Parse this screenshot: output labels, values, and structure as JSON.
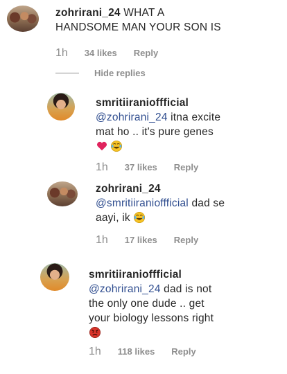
{
  "comments": [
    {
      "username": "zohrirani_24",
      "line1": "WHAT A",
      "line2": "HANDSOME MAN YOUR SON IS",
      "time": "1h",
      "likes": "34 likes",
      "reply": "Reply"
    },
    {
      "username": "smritiiranioffficial",
      "mention": "@zohrirani_24",
      "line1": "itna excite",
      "line2": "mat ho .. it's pure genes",
      "emojis": [
        "heart-emoji",
        "tears-of-joy-emoji"
      ],
      "time": "1h",
      "likes": "37 likes",
      "reply": "Reply"
    },
    {
      "username": "zohrirani_24",
      "mention": "@smritiiranioffficial",
      "line1": "dad se",
      "line2": "aayi, ik",
      "emojis": [
        "tears-of-joy-emoji"
      ],
      "time": "1h",
      "likes": "17 likes",
      "reply": "Reply"
    },
    {
      "username": "smritiiranioffficial",
      "mention": "@zohrirani_24",
      "line1": "dad is not",
      "line2": "the only one dude .. get",
      "line3": "your biology lessons right",
      "emojis": [
        "angry-face-emoji"
      ],
      "time": "1h",
      "likes": "118 likes",
      "reply": "Reply"
    }
  ],
  "hide_replies": "Hide replies",
  "colors": {
    "mention": "#2f4d8f",
    "meta": "#8e8e8e",
    "text": "#262626",
    "heart": "#e0245e"
  }
}
